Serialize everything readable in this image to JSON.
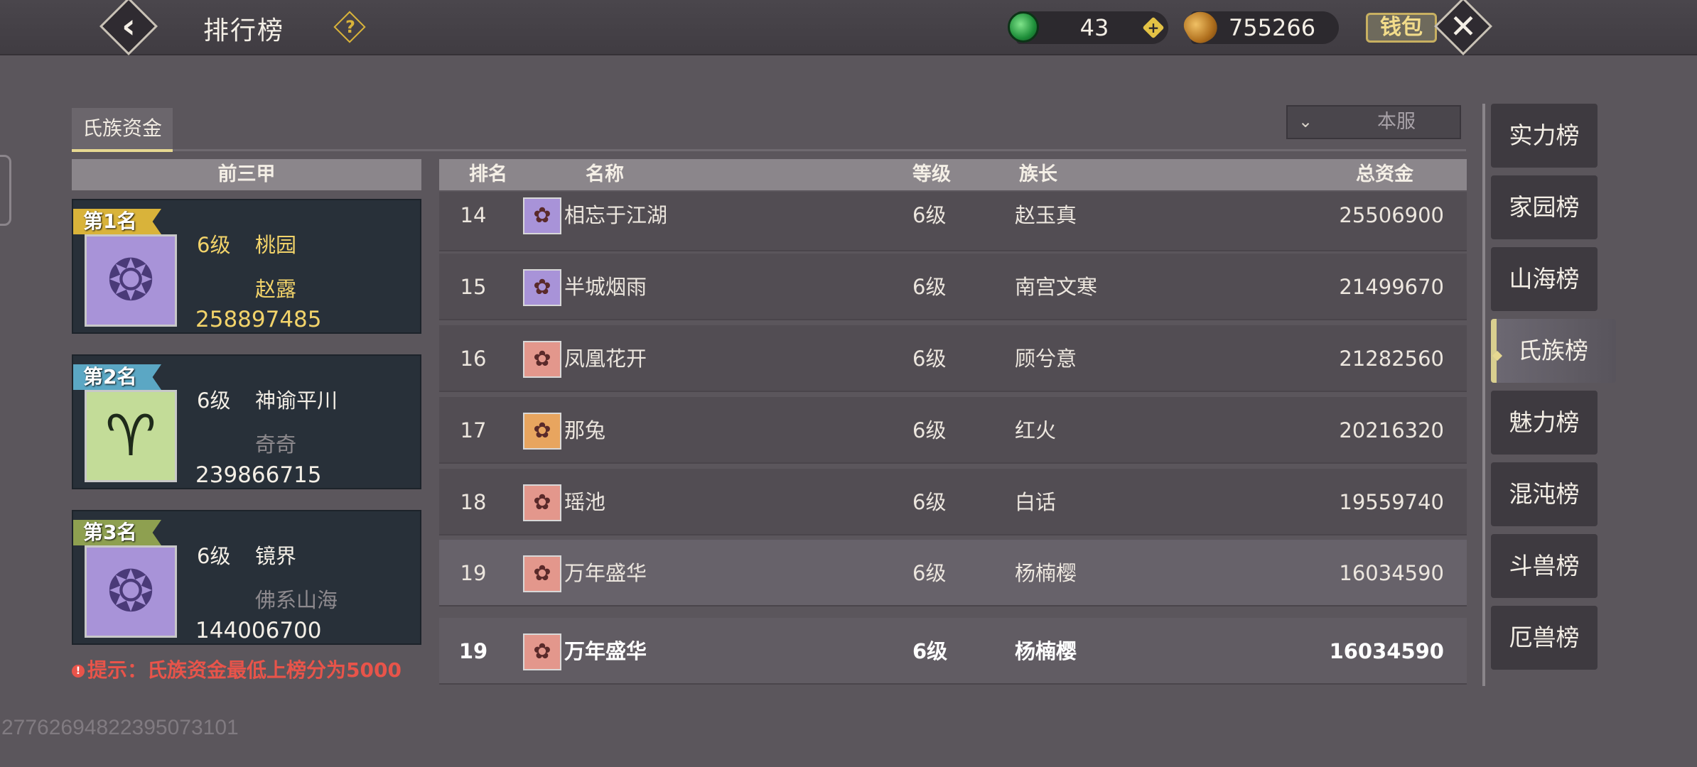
{
  "header": {
    "title": "排行榜",
    "back_icon": "back-arrow-icon",
    "help_icon": "help-icon",
    "jade_value": "43",
    "coin_value": "755266",
    "wallet_label": "钱包",
    "close_icon": "close-icon"
  },
  "tabs": {
    "active": "氏族资金"
  },
  "filter": {
    "server_label": "本服"
  },
  "top_three": {
    "header": "前三甲",
    "cards": [
      {
        "rank_label": "第1名",
        "level": "6级",
        "clan": "桃园",
        "leader": "赵露",
        "funds": "258897485",
        "ribbon_color": "#d9b33a",
        "emblem_color": "#a893d8",
        "text_color": "#f2d36a"
      },
      {
        "rank_label": "第2名",
        "level": "6级",
        "clan": "神谕平川",
        "leader": "奇奇",
        "funds": "239866715",
        "ribbon_color": "#5ba7c4",
        "emblem_color": "#c3dc98",
        "text_color": "#f4efe6"
      },
      {
        "rank_label": "第3名",
        "level": "6级",
        "clan": "镜界",
        "leader": "佛系山海",
        "funds": "144006700",
        "ribbon_color": "#8ea050",
        "emblem_color": "#a893d8",
        "text_color": "#f4efe6"
      }
    ],
    "hint": "提示：氏族资金最低上榜分为5000"
  },
  "table": {
    "columns": {
      "rank": "排名",
      "name": "名称",
      "level": "等级",
      "leader": "族长",
      "funds": "总资金"
    },
    "rows": [
      {
        "rank": "14",
        "name": "相忘于江湖",
        "level": "6级",
        "leader": "赵玉真",
        "funds": "25506900",
        "emblem_color": "#a893d8"
      },
      {
        "rank": "15",
        "name": "半城烟雨",
        "level": "6级",
        "leader": "南宫文寒",
        "funds": "21499670",
        "emblem_color": "#a893d8"
      },
      {
        "rank": "16",
        "name": "凤凰花开",
        "level": "6级",
        "leader": "顾兮意",
        "funds": "21282560",
        "emblem_color": "#e3978c"
      },
      {
        "rank": "17",
        "name": "那兔",
        "level": "6级",
        "leader": "红火",
        "funds": "20216320",
        "emblem_color": "#e8a55f"
      },
      {
        "rank": "18",
        "name": "瑶池",
        "level": "6级",
        "leader": "白话",
        "funds": "19559740",
        "emblem_color": "#e3978c"
      },
      {
        "rank": "19",
        "name": "万年盛华",
        "level": "6级",
        "leader": "杨楠樱",
        "funds": "16034590",
        "emblem_color": "#e3978c"
      }
    ],
    "self_row": {
      "rank": "19",
      "name": "万年盛华",
      "level": "6级",
      "leader": "杨楠樱",
      "funds": "16034590",
      "emblem_color": "#e3978c"
    }
  },
  "menu": {
    "items": [
      "实力榜",
      "家园榜",
      "山海榜",
      "氏族榜",
      "魅力榜",
      "混沌榜",
      "斗兽榜",
      "厄兽榜"
    ],
    "active_index": 3
  },
  "footer": {
    "uid": "27762694822395073101"
  }
}
